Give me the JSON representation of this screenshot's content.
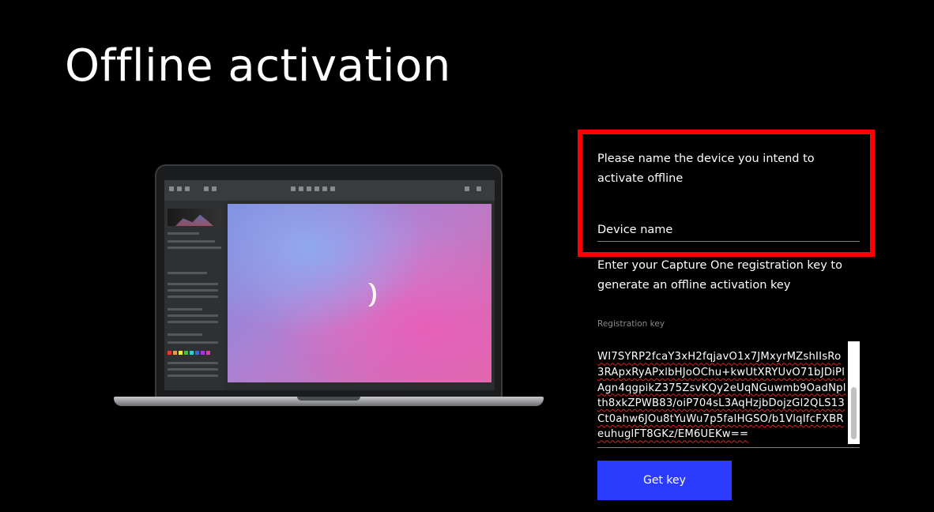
{
  "page": {
    "title": "Offline activation"
  },
  "device_section": {
    "prompt": "Please name the device you intend to activate offline",
    "device_name_placeholder": "Device name",
    "highlight_color": "#ff0000"
  },
  "registration_section": {
    "prompt": "Enter your Capture One registration key to generate an offline activation key",
    "label": "Registration key",
    "value": "WI7SYRP2fcaY3xH2fqjavO1x7JMxyrMZshIIsRo3RApxRyAPxlbHJoOChu+kwUtXRYUvO71bJDiPlAgn4qgpikZ375ZsvKQy2eUqNGuwmb9OadNplth8xkZPWB83/oiP704sL3AqHzjbDojzGl2QLS13Ct0ahw6JOu8tYuWu7p5faIHGSO/b1VlqIfcFXBReuhuglFT8GKz/EM6UEKw=="
  },
  "actions": {
    "get_key_label": "Get key",
    "button_color": "#2b3cff"
  },
  "illustration": {
    "name": "laptop-screenshot-capture-one"
  }
}
